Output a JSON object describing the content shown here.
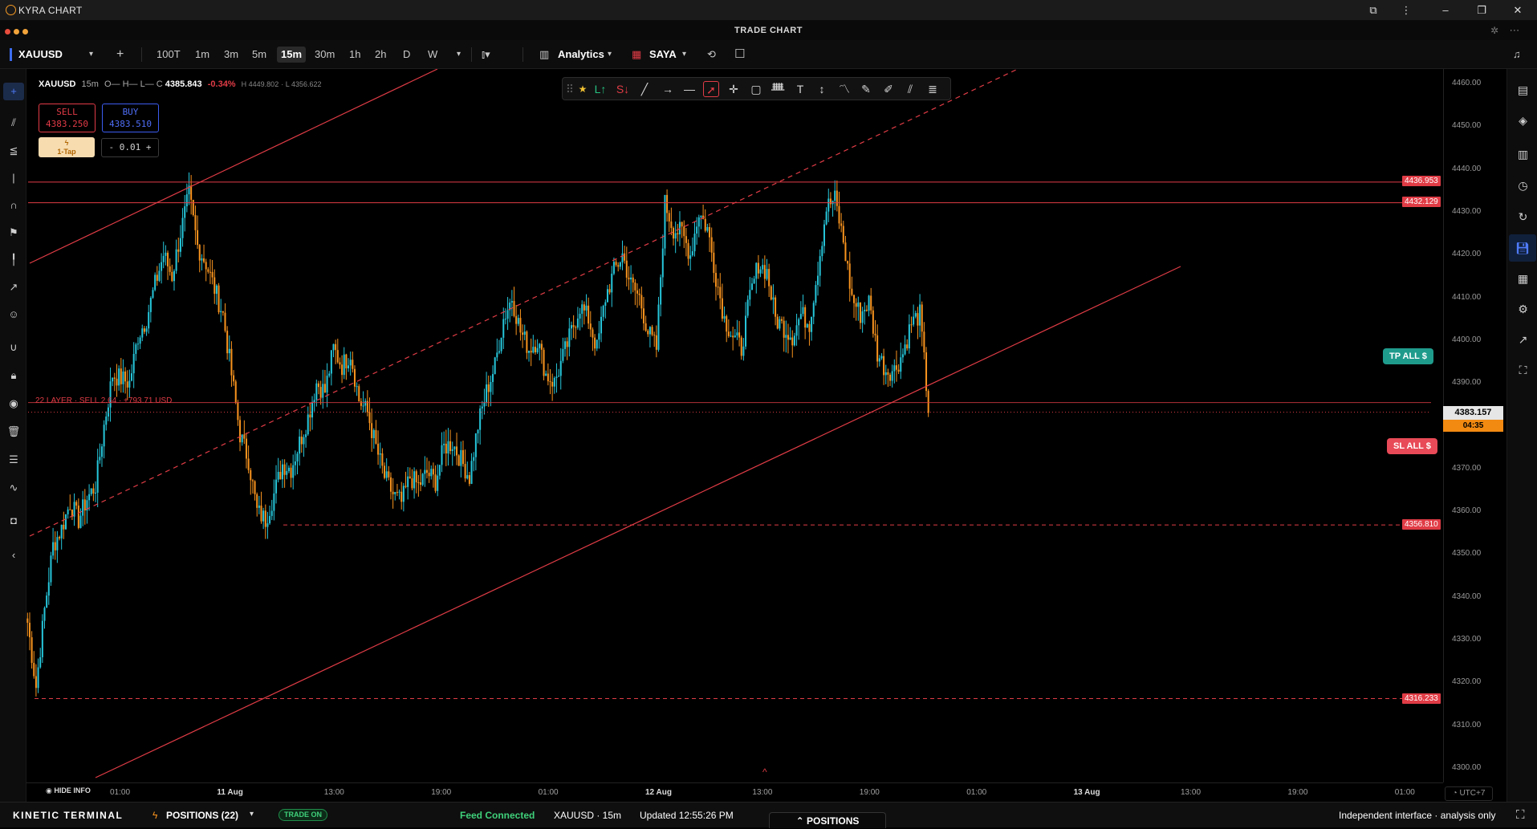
{
  "app": {
    "title": "KYRA CHART",
    "header_title": "TRADE CHART"
  },
  "toolbar": {
    "symbol": "XAUUSD",
    "timeframes": [
      "100T",
      "1m",
      "3m",
      "5m",
      "15m",
      "30m",
      "1h",
      "2h",
      "D",
      "W"
    ],
    "active_timeframe": "15m",
    "analytics_label": "Analytics",
    "saya_label": "SAYA"
  },
  "legend": {
    "symbol": "XAUUSD",
    "interval": "15m",
    "ohlc_prefix": "O— H— L— C",
    "close": "4385.843",
    "change": "-0.34%",
    "high": "H 4449.802",
    "low": "L 4356.622"
  },
  "trade": {
    "sell_label": "SELL",
    "sell_price": "4383.250",
    "buy_label": "BUY",
    "buy_price": "4383.510",
    "tap_label": "1-Tap",
    "qty_text": "- 0.01 +"
  },
  "position_line": {
    "label": "22 LAYER · SELL 2.64 · +793.71 USD"
  },
  "buttons": {
    "tp_all": "TP ALL $",
    "sl_all": "SL ALL $",
    "hide_info": "HIDE INFO"
  },
  "levels": [
    "4436.953",
    "4432.129",
    "4356.810",
    "4316.233"
  ],
  "price_axis": {
    "ticks": [
      "4460.00",
      "4450.00",
      "4440.00",
      "4430.00",
      "4420.00",
      "4410.00",
      "4400.00",
      "4390.00",
      "4380.00",
      "4370.00",
      "4360.00",
      "4350.00",
      "4340.00",
      "4330.00",
      "4320.00",
      "4310.00",
      "4300.00"
    ],
    "last_price": "4383.157",
    "countdown": "04:35",
    "timezone": "UTC+7"
  },
  "time_axis": {
    "ticks": [
      "01:00",
      "11 Aug",
      "13:00",
      "19:00",
      "01:00",
      "12 Aug",
      "13:00",
      "19:00",
      "01:00",
      "13 Aug",
      "13:00",
      "19:00",
      "01:00"
    ]
  },
  "statusbar": {
    "brand": "KINETIC TERMINAL",
    "positions": "POSITIONS (22)",
    "trade_on": "TRADE ON",
    "feed": "Feed Connected",
    "symbol_tf": "XAUUSD · 15m",
    "updated": "Updated 12:55:26 PM",
    "positions_tab": "POSITIONS",
    "note": "Independent interface · analysis only"
  },
  "colors": {
    "up": "#26c6da",
    "down": "#f7931e",
    "line": "#e03c46",
    "bg": "#000000"
  },
  "chart_data": {
    "type": "candlestick",
    "symbol": "XAUUSD",
    "interval": "15m",
    "ylim": [
      4296,
      4462
    ],
    "x_ticks": [
      "01:00",
      "11 Aug",
      "13:00",
      "19:00",
      "01:00",
      "12 Aug",
      "13:00",
      "19:00",
      "01:00",
      "13 Aug",
      "13:00",
      "19:00",
      "01:00"
    ],
    "close_path": [
      4334,
      4319,
      4337,
      4352,
      4356,
      4362,
      4358,
      4363,
      4366,
      4380,
      4392,
      4391,
      4390,
      4401,
      4405,
      4413,
      4420,
      4415,
      4425,
      4434,
      4422,
      4418,
      4412,
      4406,
      4392,
      4378,
      4372,
      4360,
      4358,
      4364,
      4371,
      4370,
      4376,
      4382,
      4390,
      4388,
      4398,
      4394,
      4397,
      4386,
      4383,
      4375,
      4368,
      4364,
      4362,
      4368,
      4366,
      4369,
      4367,
      4375,
      4376,
      4372,
      4368,
      4380,
      4388,
      4394,
      4405,
      4410,
      4402,
      4398,
      4400,
      4392,
      4390,
      4396,
      4402,
      4408,
      4405,
      4398,
      4410,
      4416,
      4420,
      4413,
      4410,
      4402,
      4398,
      4432,
      4426,
      4425,
      4420,
      4430,
      4426,
      4415,
      4405,
      4401,
      4398,
      4410,
      4418,
      4416,
      4405,
      4403,
      4401,
      4406,
      4404,
      4417,
      4431,
      4433,
      4423,
      4410,
      4406,
      4409,
      4397,
      4393,
      4393,
      4397,
      4404,
      4406,
      4384
    ],
    "price_lines": [
      4436.953,
      4432.129,
      4356.81,
      4316.233
    ],
    "position_price": 4383.157,
    "last_price": 4383.157
  }
}
